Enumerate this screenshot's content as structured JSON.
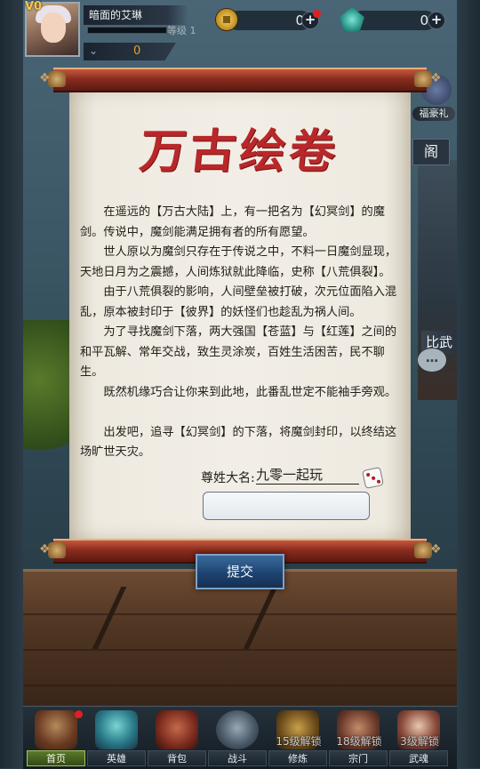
{
  "player": {
    "vip": "V0",
    "name": "暗面的艾琳",
    "level_label": "等级 1",
    "power": "0"
  },
  "resources": {
    "coins": "0",
    "gems": "0",
    "plus": "+"
  },
  "side_buttons": {
    "gift": "福豪礼",
    "pavilion": "阁",
    "arena": "比武"
  },
  "scroll": {
    "title": "万古绘卷",
    "paragraphs": [
      "在遥远的【万古大陆】上，有一把名为【幻冥剑】的魔剑。传说中，魔剑能满足拥有者的所有愿望。",
      "世人原以为魔剑只存在于传说之中，不料一日魔剑显现，天地日月为之震撼，人间炼狱就此降临，史称【八荒俱裂】。",
      "由于八荒俱裂的影响，人间壁垒被打破，次元位面陷入混乱，原本被封印于【彼界】的妖怪们也趁乱为祸人间。",
      "为了寻找魔剑下落，两大强国【苍蓝】与【红莲】之间的和平瓦解、常年交战，致生灵涂炭，百姓生活困苦，民不聊生。",
      "既然机缘巧合让你来到此地，此番乱世定不能袖手旁观。",
      "出发吧，追寻【幻冥剑】的下落，将魔剑封印，以终结这场旷世天灾。"
    ],
    "name_label": "尊姓大名:",
    "name_value": "九零一起玩",
    "input_value": "",
    "submit": "提交"
  },
  "nav": {
    "items": [
      {
        "label": "首页",
        "lock": ""
      },
      {
        "label": "英雄",
        "lock": ""
      },
      {
        "label": "背包",
        "lock": ""
      },
      {
        "label": "战斗",
        "lock": ""
      },
      {
        "label": "修炼",
        "lock": "15级解锁"
      },
      {
        "label": "宗门",
        "lock": "18级解锁"
      },
      {
        "label": "武魂",
        "lock": "3级解锁"
      }
    ]
  },
  "colors": {
    "title_red": "#b8282a",
    "rod_red": "#8a2c1e",
    "submit_blue": "#1e4472",
    "nav_active": "#5a7a2a"
  },
  "icons": {
    "coin": "coin-icon",
    "gem": "gem-icon",
    "dice": "dice-icon",
    "chat": "chat-icon"
  }
}
